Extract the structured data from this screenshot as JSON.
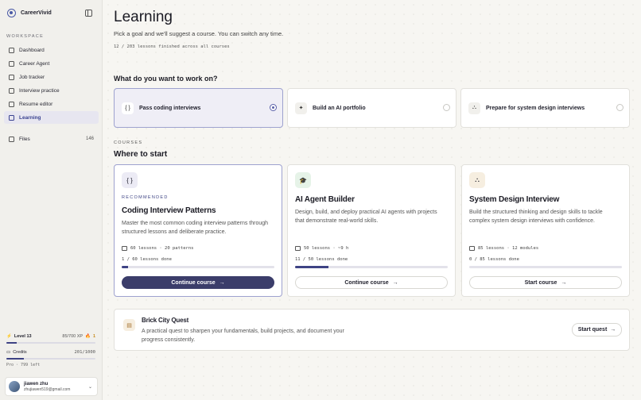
{
  "brand": {
    "name": "CareerVivid",
    "collapse_icon": "sidebar-collapse-icon"
  },
  "sidebar": {
    "section_label": "WORKSPACE",
    "items": [
      {
        "label": "Dashboard",
        "icon": "grid-icon"
      },
      {
        "label": "Career Agent",
        "icon": "agent-icon"
      },
      {
        "label": "Job tracker",
        "icon": "briefcase-icon"
      },
      {
        "label": "Interview practice",
        "icon": "mic-icon"
      },
      {
        "label": "Resume editor",
        "icon": "document-icon"
      },
      {
        "label": "Learning",
        "icon": "book-icon",
        "active": true
      }
    ],
    "files": {
      "label": "Files",
      "count": "146",
      "icon": "folder-icon"
    }
  },
  "level": {
    "label": "Level 13",
    "xp": "85/700 XP",
    "streak": "1",
    "xp_progress": 0.12
  },
  "credits": {
    "label": "Credits",
    "value": "201/1000",
    "plan": "Pro · 799 left",
    "progress": 0.2
  },
  "user": {
    "name": "jiawen zhu",
    "email": "zhujiawen519@gmail.com"
  },
  "page": {
    "title": "Learning",
    "subtitle": "Pick a goal and we'll suggest a course. You can switch any time.",
    "progress_line": "12 / 203 lessons finished across all courses"
  },
  "goals": {
    "heading": "What do you want to work on?",
    "items": [
      {
        "label": "Pass coding interviews",
        "icon": "{ }",
        "selected": true
      },
      {
        "label": "Build an AI portfolio",
        "icon": "✦",
        "selected": false
      },
      {
        "label": "Prepare for system design interviews",
        "icon": "⛬",
        "selected": false
      }
    ]
  },
  "courses": {
    "section_label": "COURSES",
    "heading": "Where to start",
    "items": [
      {
        "icon": "{ }",
        "recommended": "RECOMMENDED",
        "title": "Coding Interview Patterns",
        "description": "Master the most common coding interview patterns through structured lessons and deliberate practice.",
        "meta": "60 lessons · 20 patterns",
        "done": "1 / 60 lessons done",
        "progress": 0.0167,
        "button": "Continue course",
        "accent": "#ecebf5"
      },
      {
        "icon": "🎓",
        "title": "AI Agent Builder",
        "description": "Design, build, and deploy practical AI agents with projects that demonstrate real-world skills.",
        "meta": "50 lessons · ~9 h",
        "done": "11 / 50 lessons done",
        "progress": 0.22,
        "button": "Continue course",
        "accent": "#e6f3e8"
      },
      {
        "icon": "⛬",
        "title": "System Design Interview",
        "description": "Build the structured thinking and design skills to tackle complex system design interviews with confidence.",
        "meta": "85 lessons · 12 modules",
        "done": "0 / 85 lessons done",
        "progress": 0,
        "button": "Start course",
        "accent": "#f6eee0"
      }
    ]
  },
  "quest": {
    "title": "Brick City Quest",
    "description": "A practical quest to sharpen your fundamentals, build projects, and document your progress consistently.",
    "button": "Start quest"
  }
}
